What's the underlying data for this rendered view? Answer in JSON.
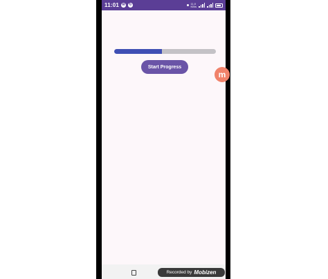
{
  "status_bar": {
    "time": "11:01",
    "network_top": "11.0",
    "network_bottom": "KB/s",
    "notification_icons": [
      "mail-icon",
      "sync-icon"
    ],
    "indicator_icons": [
      "dot-icon",
      "signal-icon",
      "signal-icon",
      "battery-icon"
    ]
  },
  "progress": {
    "value": 0.47
  },
  "start_button": {
    "label": "Start Progress"
  },
  "floating_bubble": {
    "letter": "m",
    "color": "#f0826a"
  },
  "recorder_badge": {
    "prefix": "Recorded by",
    "brand": "Mobizen"
  },
  "colors": {
    "status_bar": "#5b3e96",
    "app_background": "#fdf7fa",
    "progress_fill": "#3f4fb4",
    "progress_track": "#c4c2c6",
    "button": "#6a54a7"
  }
}
